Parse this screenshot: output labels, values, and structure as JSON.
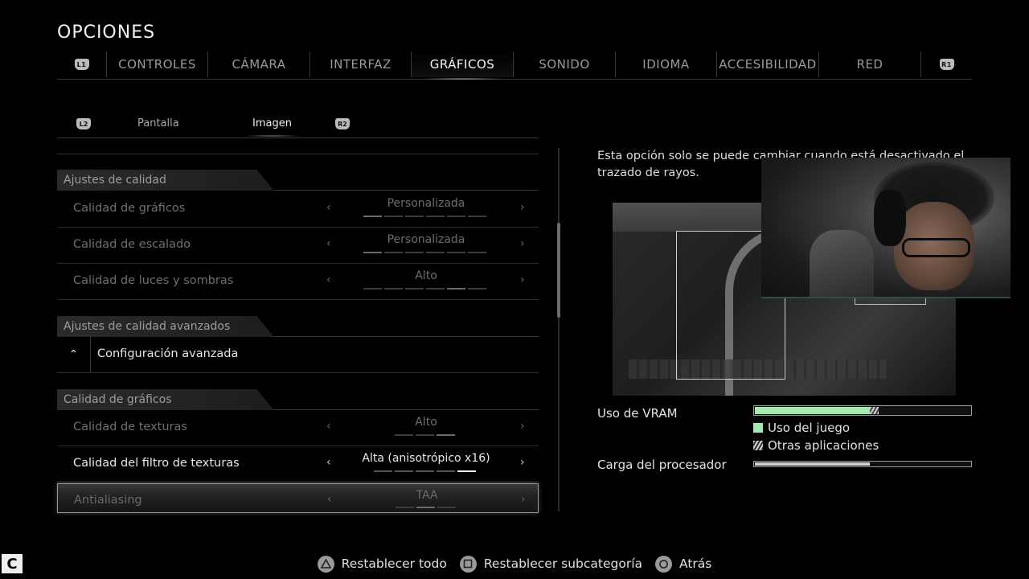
{
  "title": "OPCIONES",
  "tabbar": {
    "left_badge": "L1",
    "right_badge": "R1",
    "tabs": [
      {
        "label": "CONTROLES"
      },
      {
        "label": "CÁMARA"
      },
      {
        "label": "INTERFAZ"
      },
      {
        "label": "GRÁFICOS",
        "active": true
      },
      {
        "label": "SONIDO"
      },
      {
        "label": "IDIOMA"
      },
      {
        "label": "ACCESIBILIDAD"
      },
      {
        "label": "RED"
      }
    ]
  },
  "subtabs": {
    "left_badge": "L2",
    "right_badge": "R2",
    "items": [
      "Pantalla",
      "Imagen"
    ],
    "active": "Imagen"
  },
  "sections": {
    "quality": "Ajustes de calidad",
    "advanced": "Ajustes de calidad avanzados",
    "graphics": "Calidad de gráficos"
  },
  "rows": {
    "graphics_quality": {
      "name": "Calidad de gráficos",
      "value": "Personalizada",
      "level": 0.17
    },
    "scaling_quality": {
      "name": "Calidad de escalado",
      "value": "Personalizada",
      "level": 0.17
    },
    "lights_quality": {
      "name": "Calidad de luces y sombras",
      "value": "Alto",
      "level": 0.83
    },
    "advanced_config": {
      "name": "Configuración avanzada"
    },
    "texture_quality": {
      "name": "Calidad de texturas",
      "value": "Alto",
      "level": 1.0
    },
    "texture_filter": {
      "name": "Calidad del filtro de texturas",
      "value": "Alta (anisotrópico x16)",
      "level": 0.83
    },
    "antialiasing": {
      "name": "Antialiasing",
      "value": "TAA",
      "level": 0.67
    }
  },
  "description": "Esta opción solo se puede cambiar cuando está desactivado el trazado de rayos.",
  "vram": {
    "label": "Uso de VRAM",
    "game_fraction": 0.53,
    "other_fraction": 0.04,
    "legend_game": "Uso del juego",
    "legend_other": "Otras aplicaciones",
    "game_color": "#a8e6b4"
  },
  "cpu": {
    "label": "Carga del procesador",
    "fraction": 0.53
  },
  "footer": {
    "reset_all": "Restablecer todo",
    "reset_sub": "Restablecer subcategoría",
    "back": "Atrás"
  },
  "icons": {
    "arrow_left": "‹",
    "arrow_right": "›",
    "caret_up": "⌃"
  }
}
